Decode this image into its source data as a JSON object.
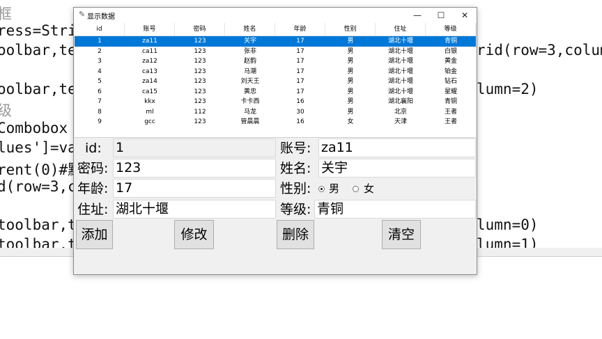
{
  "editor": {
    "lines": [
      "框",
      "ress=Stri",
      "oolbar,te",
      "",
      "oolbar,te",
      "级",
      "Combobox",
      "lues']=va",
      "rent(0)#默",
      "d(row=3,c",
      "",
      "toolbar,t",
      "toolbar,t"
    ],
    "right_fragments": [
      "rid(row=3,colum",
      "lumn=2)",
      "lumn=0)",
      "lumn=1)"
    ]
  },
  "window": {
    "title": "显示数据",
    "icon": "feather-icon",
    "controls": {
      "minimize": "—",
      "maximize": "☐",
      "close": "✕"
    }
  },
  "table": {
    "columns": [
      "id",
      "账号",
      "密码",
      "姓名",
      "年龄",
      "性别",
      "住址",
      "等级"
    ],
    "rows": [
      [
        "1",
        "za11",
        "123",
        "关宇",
        "17",
        "男",
        "湖北十堰",
        "青铜"
      ],
      [
        "2",
        "ca11",
        "123",
        "张非",
        "17",
        "男",
        "湖北十堰",
        "白银"
      ],
      [
        "3",
        "za12",
        "123",
        "赵韵",
        "17",
        "男",
        "湖北十堰",
        "黄金"
      ],
      [
        "4",
        "ca13",
        "123",
        "马潮",
        "17",
        "男",
        "湖北十堰",
        "铂金"
      ],
      [
        "5",
        "za14",
        "123",
        "刘天王",
        "17",
        "男",
        "湖北十堰",
        "钻石"
      ],
      [
        "6",
        "ca15",
        "123",
        "黄忠",
        "17",
        "男",
        "湖北十堰",
        "星耀"
      ],
      [
        "7",
        "kkx",
        "123",
        "卡卡西",
        "16",
        "男",
        "湖北襄阳",
        "青铜"
      ],
      [
        "8",
        "ml",
        "112",
        "马龙",
        "30",
        "男",
        "北京",
        "王者"
      ],
      [
        "9",
        "gcc",
        "123",
        "管晨晨",
        "16",
        "女",
        "天津",
        "王者"
      ]
    ],
    "selected_index": 0
  },
  "form": {
    "id_label": "id:",
    "id_value": "1",
    "account_label": "账号:",
    "account_value": "za11",
    "password_label": "密码:",
    "password_value": "123",
    "name_label": "姓名:",
    "name_value": "关宇",
    "age_label": "年龄:",
    "age_value": "17",
    "gender_label": "性别:",
    "gender_male": "男",
    "gender_female": "女",
    "gender_selected": "男",
    "address_label": "住址:",
    "address_value": "湖北十堰",
    "level_label": "等级:",
    "level_value": "青铜"
  },
  "buttons": {
    "add": "添加",
    "modify": "修改",
    "delete": "删除",
    "clear": "清空"
  }
}
